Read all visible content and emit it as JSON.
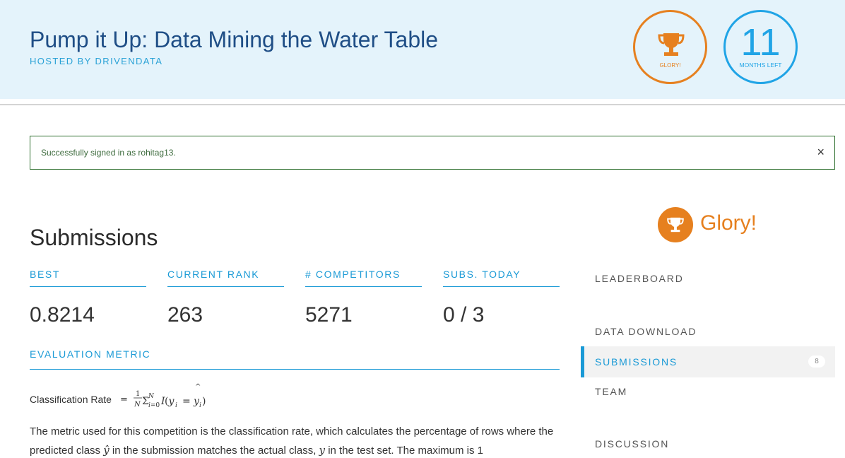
{
  "header": {
    "title": "Pump it Up: Data Mining the Water Table",
    "host": "HOSTED BY DRIVENDATA",
    "badge_glory": {
      "label": "GLORY!",
      "icon": "trophy-icon"
    },
    "badge_months": {
      "number": "11",
      "label": "MONTHS LEFT"
    }
  },
  "alert": {
    "text": "Successfully signed in as rohitag13.",
    "close": "×"
  },
  "main": {
    "title": "Submissions",
    "stats": [
      {
        "label": "BEST",
        "value": "0.8214"
      },
      {
        "label": "CURRENT RANK",
        "value": "263"
      },
      {
        "label": "# COMPETITORS",
        "value": "5271"
      },
      {
        "label": "SUBS. TODAY",
        "value": "0 / 3"
      }
    ],
    "eval_metric": {
      "heading": "EVALUATION METRIC",
      "formula_label": "Classification Rate",
      "body_part1": "The metric used for this competition is the classification rate, which calculates the percentage of rows where the predicted class",
      "body_part2": "in the submission matches the actual class,",
      "body_part3": "in the test set. The maximum is 1"
    }
  },
  "sidebar": {
    "prize": "Glory!",
    "nav": [
      {
        "label": "LEADERBOARD",
        "active": false
      },
      {
        "label": "DATA DOWNLOAD",
        "active": false
      },
      {
        "label": "SUBMISSIONS",
        "active": true,
        "count": "8"
      },
      {
        "label": "TEAM",
        "active": false
      },
      {
        "label": "DISCUSSION",
        "active": false
      }
    ]
  },
  "colors": {
    "orange": "#e6801f",
    "blue": "#1a9ad6",
    "title_blue": "#1f4e86",
    "header_bg": "#e4f3fb"
  }
}
